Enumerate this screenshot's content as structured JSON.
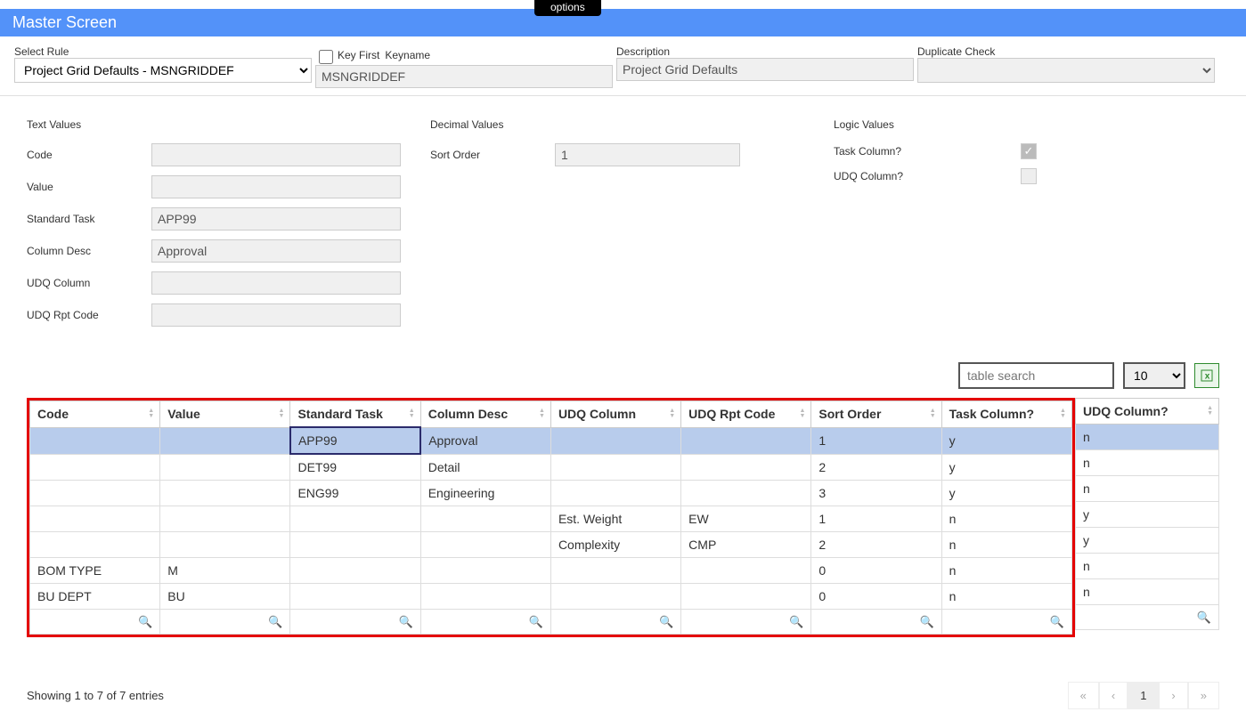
{
  "options_label": "options",
  "title": "Master Screen",
  "top": {
    "select_rule_label": "Select Rule",
    "select_rule_value": "Project Grid Defaults - MSNGRIDDEF",
    "key_first_label": "Key First",
    "keyname_label": "Keyname",
    "keyname_value": "MSNGRIDDEF",
    "description_label": "Description",
    "description_value": "Project Grid Defaults",
    "dupe_label": "Duplicate Check",
    "dupe_value": ""
  },
  "sections": {
    "text": {
      "heading": "Text Values",
      "code_label": "Code",
      "code_value": "",
      "value_label": "Value",
      "value_value": "",
      "stdtask_label": "Standard Task",
      "stdtask_value": "APP99",
      "coldesc_label": "Column Desc",
      "coldesc_value": "Approval",
      "udqcol_label": "UDQ Column",
      "udqcol_value": "",
      "udqrpt_label": "UDQ Rpt Code",
      "udqrpt_value": ""
    },
    "decimal": {
      "heading": "Decimal Values",
      "sort_label": "Sort Order",
      "sort_value": "1"
    },
    "logic": {
      "heading": "Logic Values",
      "task_label": "Task Column?",
      "task_checked": true,
      "udq_label": "UDQ Column?",
      "udq_checked": false
    }
  },
  "table": {
    "search_placeholder": "table search",
    "pagesize": "10",
    "headers": [
      "Code",
      "Value",
      "Standard Task",
      "Column Desc",
      "UDQ Column",
      "UDQ Rpt Code",
      "Sort Order",
      "Task Column?",
      "UDQ Column?"
    ],
    "rows": [
      {
        "code": "",
        "value": "",
        "stdtask": "APP99",
        "coldesc": "Approval",
        "udqcol": "",
        "udqrpt": "",
        "sort": "1",
        "taskcol": "y",
        "udqcolq": "n",
        "selected": true,
        "focus_col": 2
      },
      {
        "code": "",
        "value": "",
        "stdtask": "DET99",
        "coldesc": "Detail",
        "udqcol": "",
        "udqrpt": "",
        "sort": "2",
        "taskcol": "y",
        "udqcolq": "n"
      },
      {
        "code": "",
        "value": "",
        "stdtask": "ENG99",
        "coldesc": "Engineering",
        "udqcol": "",
        "udqrpt": "",
        "sort": "3",
        "taskcol": "y",
        "udqcolq": "n"
      },
      {
        "code": "",
        "value": "",
        "stdtask": "",
        "coldesc": "",
        "udqcol": "Est. Weight",
        "udqrpt": "EW",
        "sort": "1",
        "taskcol": "n",
        "udqcolq": "y"
      },
      {
        "code": "",
        "value": "",
        "stdtask": "",
        "coldesc": "",
        "udqcol": "Complexity",
        "udqrpt": "CMP",
        "sort": "2",
        "taskcol": "n",
        "udqcolq": "y"
      },
      {
        "code": "BOM TYPE",
        "value": "M",
        "stdtask": "",
        "coldesc": "",
        "udqcol": "",
        "udqrpt": "",
        "sort": "0",
        "taskcol": "n",
        "udqcolq": "n"
      },
      {
        "code": "BU DEPT",
        "value": "BU",
        "stdtask": "",
        "coldesc": "",
        "udqcol": "",
        "udqrpt": "",
        "sort": "0",
        "taskcol": "n",
        "udqcolq": "n"
      }
    ]
  },
  "footer": {
    "info": "Showing 1 to 7 of 7 entries",
    "page": "1"
  }
}
